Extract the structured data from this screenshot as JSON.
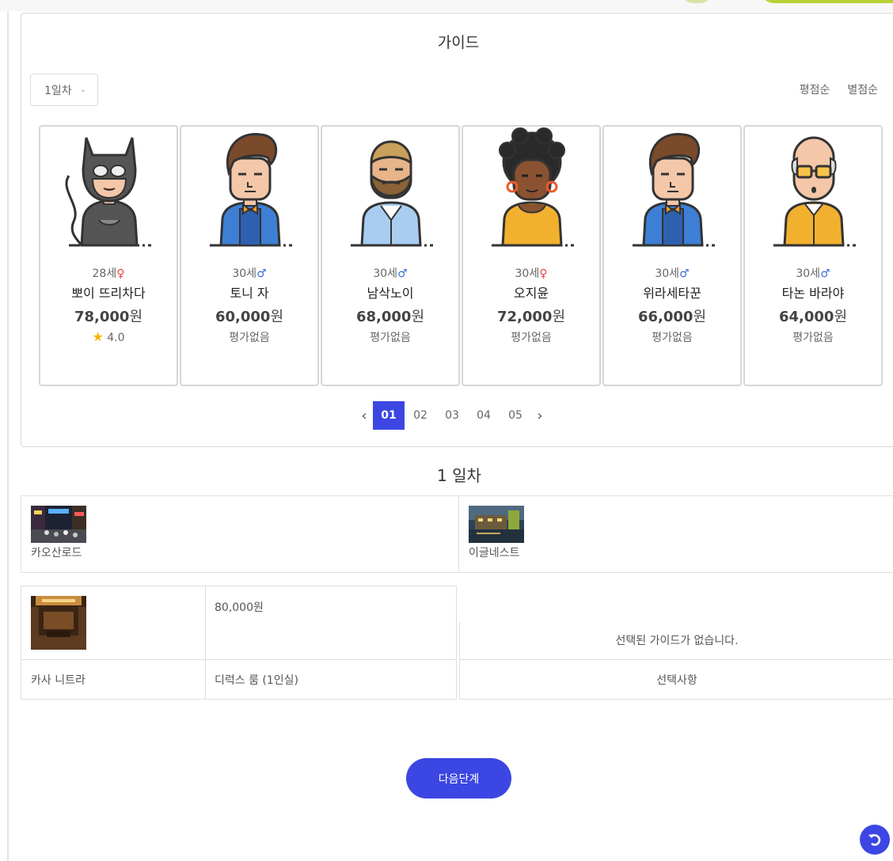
{
  "colors": {
    "accent": "#3c46e3",
    "female": "#ec4343",
    "male": "#3d6fd8",
    "star": "#f5b400"
  },
  "guide": {
    "title": "가이드",
    "day_select": {
      "value": "1일차"
    },
    "sort": [
      "평점순",
      "별점순"
    ],
    "cards": [
      {
        "age": "28세",
        "gender": "♀",
        "gender_type": "female",
        "name": "뽀이 뜨리차다",
        "price": "78,000",
        "unit": "원",
        "rating": "4.0",
        "rated": true,
        "avatar": "cat-mask-avatar"
      },
      {
        "age": "30세",
        "gender": "♂",
        "gender_type": "male",
        "name": "토니 자",
        "price": "60,000",
        "unit": "원",
        "rating": "평가없음",
        "rated": false,
        "avatar": "quiff-man-avatar"
      },
      {
        "age": "30세",
        "gender": "♂",
        "gender_type": "male",
        "name": "남삭노이",
        "price": "68,000",
        "unit": "원",
        "rating": "평가없음",
        "rated": false,
        "avatar": "bearded-man-avatar"
      },
      {
        "age": "30세",
        "gender": "♀",
        "gender_type": "female",
        "name": "오지윤",
        "price": "72,000",
        "unit": "원",
        "rating": "평가없음",
        "rated": false,
        "avatar": "curly-woman-avatar"
      },
      {
        "age": "30세",
        "gender": "♂",
        "gender_type": "male",
        "name": "위라세타꾼",
        "price": "66,000",
        "unit": "원",
        "rating": "평가없음",
        "rated": false,
        "avatar": "quiff-man-avatar"
      },
      {
        "age": "30세",
        "gender": "♂",
        "gender_type": "male",
        "name": "타논 바라야",
        "price": "64,000",
        "unit": "원",
        "rating": "평가없음",
        "rated": false,
        "avatar": "bald-glasses-man-avatar"
      }
    ],
    "pagination": {
      "pages": [
        "01",
        "02",
        "03",
        "04",
        "05"
      ],
      "current": "01",
      "prev_icon": "chevron-left-icon",
      "next_icon": "chevron-right-icon"
    }
  },
  "day": {
    "heading": "1 일차",
    "spots": [
      {
        "name": "카오산로드",
        "thumb": "night-street-photo"
      },
      {
        "name": "이글네스트",
        "thumb": "riverside-hotel-photo"
      }
    ],
    "hotel": {
      "price": "80,000원",
      "name": "카사 니트라",
      "room": "디럭스 룸 (1인실)",
      "thumb": "hotel-lobby-photo"
    },
    "selected_guide": {
      "empty_message": "선택된 가이드가 없습니다.",
      "options_label": "선택사항"
    }
  },
  "actions": {
    "next_label": "다음단계",
    "refresh_icon": "refresh-icon"
  }
}
